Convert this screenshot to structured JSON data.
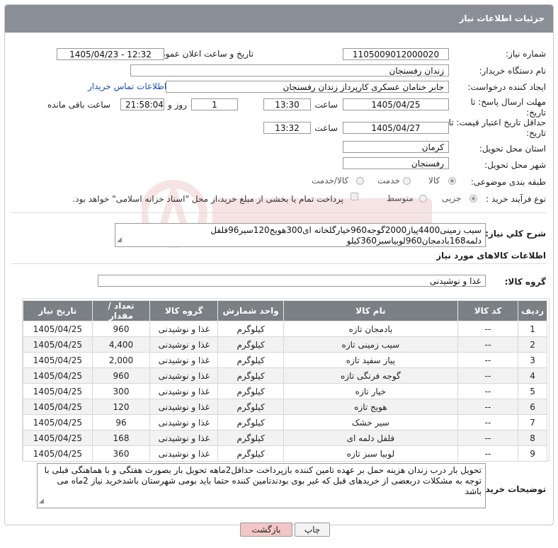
{
  "header": {
    "title": "جزئیات اطلاعات نیاز"
  },
  "form": {
    "need_number_label": "شماره نیاز:",
    "need_number": "1105009012000020",
    "announce_label": "تاریخ و ساعت اعلان عمومی:",
    "announce_value": "1405/04/23 - 12:32",
    "buyer_label": "نام دستگاه خریدار:",
    "buyer_value": "زندان رفسنجان",
    "creator_label": "ایجاد کننده درخواست:",
    "creator_value": "جابر خنامان عسکری کارپرداز زندان رفسنجان",
    "contact_link": "اطلاعات تماس خریدار",
    "deadline_label": "مهلت ارسال پاسخ: تا تاریخ:",
    "deadline_date": "1405/04/25",
    "time_label": "ساعت",
    "deadline_time": "13:30",
    "day_label": "روز و",
    "deadline_days": "1",
    "remaining_label": "ساعت باقی مانده",
    "remaining_time": "21:58:04",
    "validity_label": "حداقل تاریخ اعتبار قیمت: تا تاریخ:",
    "validity_date": "1405/04/27",
    "validity_time": "13:32",
    "province_label": "استان محل تحویل:",
    "province_value": "کرمان",
    "city_label": "شهر محل تحویل:",
    "city_value": "رفسنجان",
    "category_label": "طبقه بندی موضوعی:",
    "category_options": [
      "کالا",
      "خدمت",
      "کالا/خدمت"
    ],
    "category_selected": "کالا",
    "purchase_label": "نوع فرآیند خرید :",
    "purchase_options": [
      "جزیی",
      "متوسط"
    ],
    "purchase_selected": "جزیی",
    "payment_note": "پرداخت تمام یا بخشی از مبلغ خرید،از محل \"اسناد خزانه اسلامی\" خواهد بود.",
    "summary_label": "شرح کلي نياز:",
    "summary_text": "سیب زمینی4400پیاز2000گوجه960خیارگلخانه ای300هویج120سیر96فلفل دلمه168بادمجان960لوبیاسبز360کیلو",
    "goods_info_title": "اطلاعات کالاهای مورد نیاز",
    "goods_group_label": "گروه کالا:",
    "goods_group_value": "غذا و نوشیدنی",
    "buyer_notes_label": "توضیحات خریدار:",
    "buyer_notes": "تحویل بار درب زندان هزینه حمل بر عهده تامین کننده بازپرداخت حداقل2ماهه تحویل بار بصورت هفتگی و با هماهنگی قبلی با توجه به مشکلات دربعضی از خریدهای قبل که غیر بوی بودندتامین کننده حتما باید بومی شهرستان باشدخرید نیاز 2ماه می باشد"
  },
  "table": {
    "headers": [
      "ردیف",
      "کد کالا",
      "نام کالا",
      "واحد شمارش",
      "گروه کالا",
      "تعداد / مقدار",
      "تاریخ نیاز"
    ],
    "rows": [
      [
        "1",
        "--",
        "بادمجان تازه",
        "کیلوگرم",
        "غذا و نوشیدنی",
        "960",
        "1405/04/25"
      ],
      [
        "2",
        "--",
        "سیب زمینی تازه",
        "کیلوگرم",
        "غذا و نوشیدنی",
        "4,400",
        "1405/04/25"
      ],
      [
        "3",
        "--",
        "پیاز سفید تازه",
        "کیلوگرم",
        "غذا و نوشیدنی",
        "2,000",
        "1405/04/25"
      ],
      [
        "4",
        "--",
        "گوجه فرنگی تازه",
        "کیلوگرم",
        "غذا و نوشیدنی",
        "960",
        "1405/04/25"
      ],
      [
        "5",
        "--",
        "خیار تازه",
        "کیلوگرم",
        "غذا و نوشیدنی",
        "300",
        "1405/04/25"
      ],
      [
        "6",
        "--",
        "هویج تازه",
        "کیلوگرم",
        "غذا و نوشیدنی",
        "120",
        "1405/04/25"
      ],
      [
        "7",
        "--",
        "سیر خشک",
        "کیلوگرم",
        "غذا و نوشیدنی",
        "96",
        "1405/04/25"
      ],
      [
        "8",
        "--",
        "فلفل دلمه ای",
        "کیلوگرم",
        "غذا و نوشیدنی",
        "168",
        "1405/04/25"
      ],
      [
        "9",
        "--",
        "لوبیا سبز تازه",
        "کیلوگرم",
        "غذا و نوشیدنی",
        "360",
        "1405/04/25"
      ]
    ]
  },
  "buttons": {
    "print": "چاپ",
    "back": "بازگشت"
  },
  "colors": {
    "header_bg": "#8a8f97",
    "table_header_bg": "#7b8085",
    "link": "#1a4fb3",
    "back_button_bg": "#f4c6c6"
  }
}
